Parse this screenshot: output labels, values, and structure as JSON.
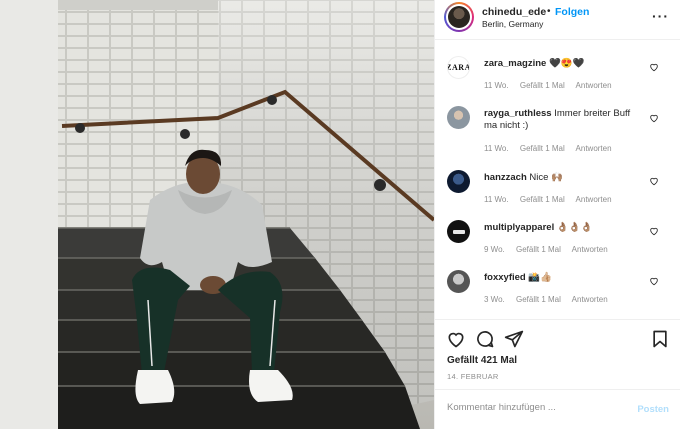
{
  "header": {
    "username": "chinedu_ede",
    "separator": "•",
    "follow_label": "Folgen",
    "location": "Berlin, Germany",
    "more_icon": "more-horizontal-icon"
  },
  "comments": [
    {
      "user": "zara_magzine",
      "text": "🖤😍🖤",
      "age": "11 Wo.",
      "likes": "Gefällt 1 Mal",
      "reply": "Antworten",
      "avatar": "zara-logo"
    },
    {
      "user": "rayga_ruthless",
      "text": "Immer breiter Buff ma nicht :)",
      "age": "11 Wo.",
      "likes": "Gefällt 1 Mal",
      "reply": "Antworten",
      "avatar": "user-photo"
    },
    {
      "user": "hanzzach",
      "text": "Nice 🙌🏽",
      "age": "11 Wo.",
      "likes": "Gefällt 1 Mal",
      "reply": "Antworten",
      "avatar": "user-photo"
    },
    {
      "user": "multiplyapparel",
      "text": "👌🏽👌🏽👌🏽",
      "age": "9 Wo.",
      "likes": "Gefällt 1 Mal",
      "reply": "Antworten",
      "avatar": "brand-logo"
    },
    {
      "user": "foxxyfied",
      "text": "📸👍🏼",
      "age": "3 Wo.",
      "likes": "Gefällt 1 Mal",
      "reply": "Antworten",
      "avatar": "user-photo"
    }
  ],
  "actions": {
    "like_icon": "heart-icon",
    "comment_icon": "comment-icon",
    "share_icon": "share-icon",
    "save_icon": "bookmark-icon"
  },
  "likes_text": "Gefällt 421 Mal",
  "date_text": "14. FEBRUAR",
  "add_comment": {
    "placeholder": "Kommentar hinzufügen ...",
    "post_label": "Posten"
  },
  "colors": {
    "follow": "#0095f6",
    "post_disabled": "#b2dffc",
    "meta": "#8e8e8e",
    "text": "#262626"
  }
}
